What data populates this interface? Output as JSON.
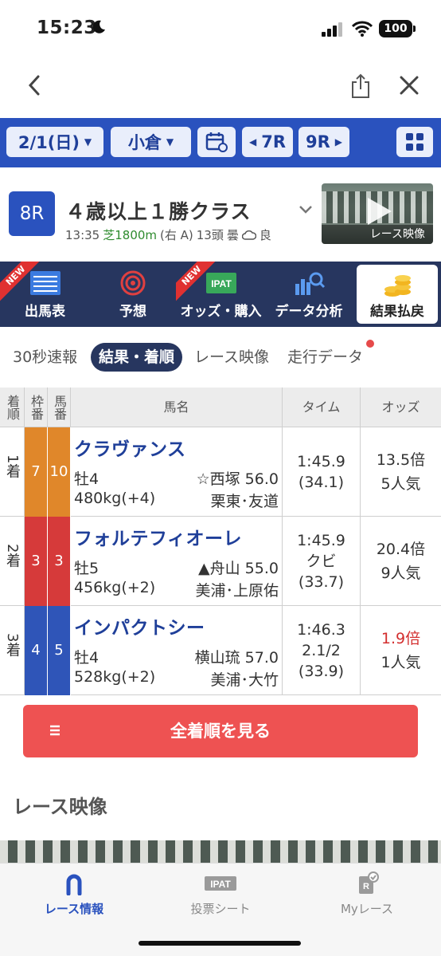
{
  "status": {
    "time": "15:23",
    "battery": "100"
  },
  "selector": {
    "date": "2/1(日)",
    "venue": "小倉",
    "prev_race": "7R",
    "next_race": "9R"
  },
  "race": {
    "number": "8R",
    "title": "４歳以上１勝クラス",
    "start_time": "13:35",
    "surface": "芝1800m",
    "course": "(右 A)",
    "runners": "13頭",
    "weather": "曇",
    "going": "良",
    "video_label": "レース映像"
  },
  "menu": [
    {
      "label": "出馬表",
      "new": true
    },
    {
      "label": "予想",
      "new": false
    },
    {
      "label": "オッズ・購入",
      "new": true
    },
    {
      "label": "データ分析",
      "new": false
    },
    {
      "label": "結果払戻",
      "new": false
    }
  ],
  "new_badge": "NEW",
  "subtabs": [
    "30秒速報",
    "結果・着順",
    "レース映像",
    "走行データ"
  ],
  "table": {
    "headers": {
      "rank": "着順",
      "waku": "枠番",
      "umaban": "馬番",
      "name": "馬名",
      "time": "タイム",
      "odds": "オッズ"
    },
    "rows": [
      {
        "rank": "1着",
        "waku": "7",
        "umaban": "10",
        "waku_color": "#e0872a",
        "name": "クラヴァンス",
        "sex_age": "牡4",
        "weight": "480kg(+4)",
        "jockey": "☆西塚 56.0",
        "trainer": "栗東･友道",
        "time": "1:45.9",
        "margin": "",
        "last3f": "(34.1)",
        "odds": "13.5倍",
        "pop": "5人気",
        "fav": false
      },
      {
        "rank": "2着",
        "waku": "3",
        "umaban": "3",
        "waku_color": "#d63a3a",
        "name": "フォルテフィオーレ",
        "sex_age": "牡5",
        "weight": "456kg(+2)",
        "jockey": "▲舟山 55.0",
        "trainer": "美浦･上原佑",
        "time": "1:45.9",
        "margin": "クビ",
        "last3f": "(33.7)",
        "odds": "20.4倍",
        "pop": "9人気",
        "fav": false
      },
      {
        "rank": "3着",
        "waku": "4",
        "umaban": "5",
        "waku_color": "#2f55b8",
        "name": "インパクトシー",
        "sex_age": "牡4",
        "weight": "528kg(+2)",
        "jockey": "横山琉 57.0",
        "trainer": "美浦･大竹",
        "time": "1:46.3",
        "margin": "2.1/2",
        "last3f": "(33.9)",
        "odds": "1.9倍",
        "pop": "1人気",
        "fav": true
      }
    ]
  },
  "full_order_button": "全着順を見る",
  "video_section_title": "レース映像",
  "tabbar": {
    "race_info": "レース情報",
    "vote_sheet": "投票シート",
    "my_race": "Myレース",
    "ipat": "IPAT"
  }
}
